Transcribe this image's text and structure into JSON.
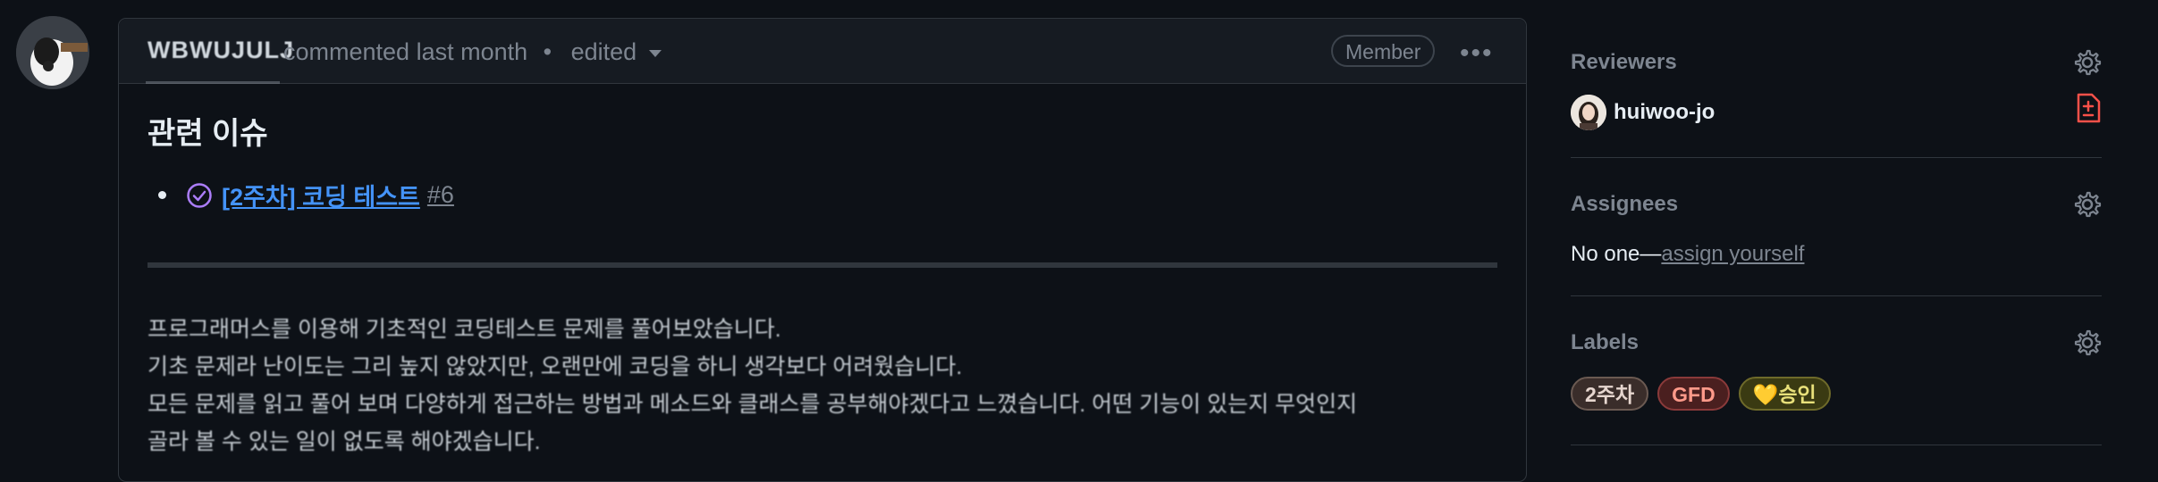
{
  "comment": {
    "author": "WBWUJULJ",
    "meta_text": "commented last month",
    "separator": "•",
    "edited_label": "edited",
    "role_badge": "Member",
    "more_label": "•••",
    "heading": "관련 이슈",
    "issue": {
      "title": "[2주차] 코딩 테스트",
      "number": "#6",
      "state_icon": "check-circle-icon"
    },
    "paragraph_lines": [
      "프로그래머스를 이용해 기초적인 코딩테스트 문제를 풀어보았습니다.",
      "기초 문제라 난이도는 그리 높지 않았지만, 오랜만에 코딩을 하니 생각보다 어려웠습니다.",
      "모든 문제를 읽고 풀어 보며 다양하게 접근하는 방법과 메소드와 클래스를 공부해야겠다고 느꼈습니다. 어떤 기능이 있는지 무엇인지",
      "골라 볼 수 있는 일이 없도록 해야겠습니다."
    ]
  },
  "sidebar": {
    "reviewers": {
      "title": "Reviewers",
      "items": [
        {
          "name": "huiwoo-jo",
          "status_icon": "file-diff-icon"
        }
      ]
    },
    "assignees": {
      "title": "Assignees",
      "none_prefix": "No one—",
      "assign_link": "assign yourself"
    },
    "labels": {
      "title": "Labels",
      "items": [
        {
          "name": "2주차",
          "bg": "#3a2d2a",
          "border": "#6b5a52",
          "color": "#e6d6cf"
        },
        {
          "name": "GFD",
          "bg": "#4a1f1f",
          "border": "#8a3a3a",
          "color": "#ff9a8a"
        },
        {
          "name": "💛승인",
          "bg": "#3a3a12",
          "border": "#6e6a2a",
          "color": "#e8e07a"
        }
      ]
    }
  },
  "colors": {
    "accent": "#4493f8",
    "muted": "#7d8590",
    "danger": "#f85149",
    "done": "#ab7df8"
  }
}
